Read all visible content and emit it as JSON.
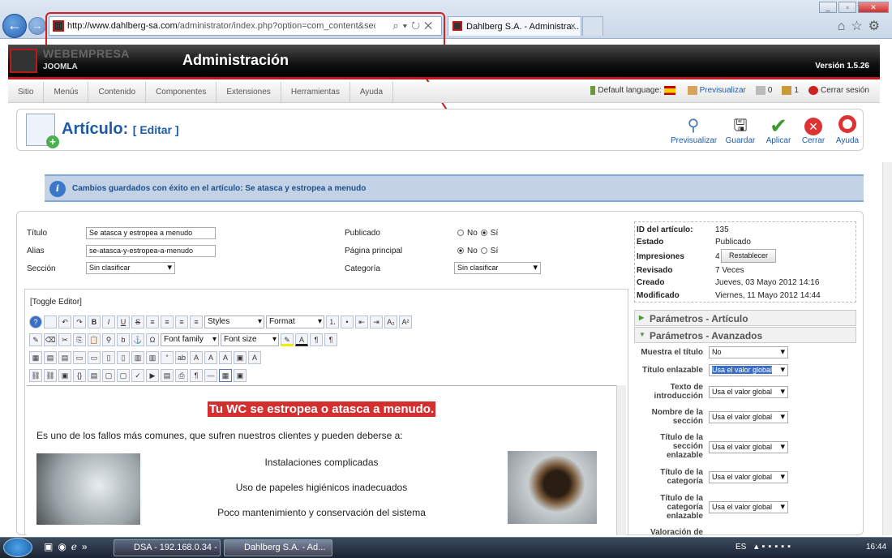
{
  "browser": {
    "url_host": "http://www.dahlberg-sa.com",
    "url_path": "/administrator/index.php?option=com_content&sectionid=",
    "tab_title": "Dahlberg S.A. - Administra...",
    "tab_close": "×"
  },
  "header": {
    "brand": "WEBEMPRESA",
    "brand_sub": "JOOMLA",
    "title": "Administración",
    "version": "Versión 1.5.26"
  },
  "menu": [
    "Sitio",
    "Menús",
    "Contenido",
    "Componentes",
    "Extensiones",
    "Herramientas",
    "Ayuda"
  ],
  "status": {
    "language": "Default language:",
    "preview": "Previsualizar",
    "messages": "0",
    "users": "1",
    "logout": "Cerrar sesión"
  },
  "page": {
    "title": "Artículo:",
    "subtitle": "[ Editar ]"
  },
  "toolbar": [
    {
      "label": "Previsualizar",
      "icon": "magnifier-icon"
    },
    {
      "label": "Guardar",
      "icon": "save-icon"
    },
    {
      "label": "Aplicar",
      "icon": "checkmark-icon"
    },
    {
      "label": "Cerrar",
      "icon": "close-icon"
    },
    {
      "label": "Ayuda",
      "icon": "help-icon"
    }
  ],
  "message": "Cambios guardados con éxito en el artículo: Se atasca y estropea a menudo",
  "form": {
    "title_label": "Título",
    "title_value": "Se atasca y estropea a menudo",
    "alias_label": "Alias",
    "alias_value": "se-atasca-y-estropea-a-menudo",
    "section_label": "Sección",
    "section_value": "Sin clasificar",
    "published_label": "Publicado",
    "frontpage_label": "Página principal",
    "category_label": "Categoría",
    "category_value": "Sin clasificar",
    "no": "No",
    "yes": "Sí"
  },
  "editor": {
    "toggle": "[Toggle Editor]",
    "styles": "Styles",
    "format": "Format",
    "font_family": "Font family",
    "font_size": "Font size",
    "heading": "Tu WC se estropea o atasca a menudo.",
    "intro": "Es uno de los fallos más comunes, que sufren nuestros clientes  y pueden deberse a:",
    "items": [
      "Instalaciones  complicadas",
      "Uso de papeles higiénicos inadecuados",
      "Poco mantenimiento y conservación del sistema"
    ]
  },
  "info": [
    {
      "k": "ID del artículo:",
      "v": "135"
    },
    {
      "k": "Estado",
      "v": "Publicado"
    },
    {
      "k": "Impresiones",
      "v": "4"
    },
    {
      "k": "Revisado",
      "v": "7 Veces"
    },
    {
      "k": "Creado",
      "v": "Jueves, 03 Mayo 2012 14:16"
    },
    {
      "k": "Modificado",
      "v": "Viernes, 11 Mayo 2012 14:44"
    }
  ],
  "reset_button": "Restablecer",
  "params_article": "Parámetros - Artículo",
  "params_advanced": "Parámetros - Avanzados",
  "advanced": [
    {
      "label": "Muestra el título",
      "value": "No"
    },
    {
      "label": "Título enlazable",
      "value": "Usa el valor global"
    },
    {
      "label": "Texto de introducción",
      "value": "Usa el valor global"
    },
    {
      "label": "Nombre de la sección",
      "value": "Usa el valor global"
    },
    {
      "label": "Título de la sección enlazable",
      "value": "Usa el valor global"
    },
    {
      "label": "Título de la categoría",
      "value": "Usa el valor global"
    },
    {
      "label": "Título de la categoría enlazable",
      "value": "Usa el valor global"
    },
    {
      "label": "Valoración de",
      "value": ""
    }
  ],
  "taskbar": {
    "item1": "DSA - 192.168.0.34 - ...",
    "item2": "Dahlberg S.A. - Ad...",
    "lang": "ES",
    "time": "16:44"
  }
}
